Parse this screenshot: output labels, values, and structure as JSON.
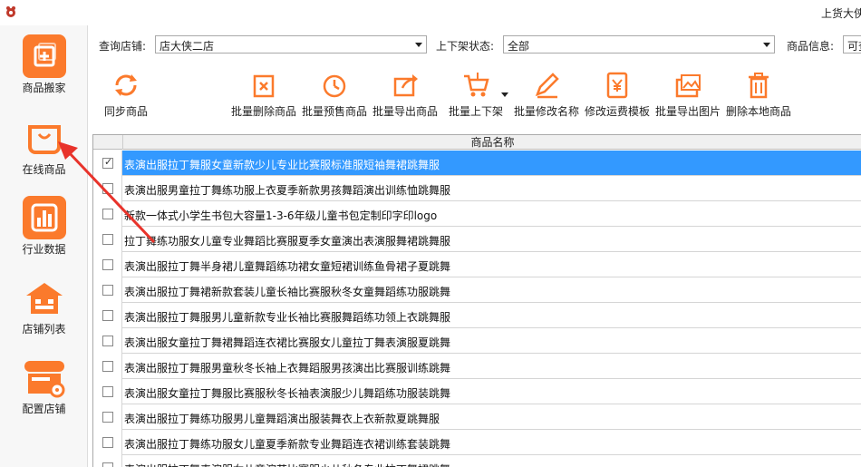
{
  "window": {
    "title": "上货大侠"
  },
  "sidebar": {
    "items": [
      {
        "label": "商品搬家",
        "icon": "plus-icon"
      },
      {
        "label": "在线商品",
        "icon": "bag-icon"
      },
      {
        "label": "行业数据",
        "icon": "bar-chart-icon"
      },
      {
        "label": "店铺列表",
        "icon": "store-icon"
      },
      {
        "label": "配置店铺",
        "icon": "store-gear-icon"
      }
    ]
  },
  "filters": {
    "shop_label": "查询店铺:",
    "shop_value": "店大侠二店",
    "status_label": "上下架状态:",
    "status_value": "全部",
    "info_label": "商品信息:",
    "info_value": "可查"
  },
  "toolbar": {
    "sync_label": "同步商品",
    "buttons": [
      "批量删除商品",
      "批量预售商品",
      "批量导出商品",
      "批量上下架",
      "批量修改名称",
      "修改运费模板",
      "批量导出图片",
      "删除本地商品"
    ]
  },
  "grid": {
    "header": "商品名称",
    "rows": [
      {
        "name": "表演出服拉丁舞服女童新款少儿专业比赛服标准服短袖舞裙跳舞服",
        "checked": true,
        "selected": true
      },
      {
        "name": "表演出服男童拉丁舞练功服上衣夏季新款男孩舞蹈演出训练恤跳舞服",
        "checked": false,
        "selected": false
      },
      {
        "name": "新款一体式小学生书包大容量1-3-6年级儿童书包定制印字印logo",
        "checked": false,
        "selected": false
      },
      {
        "name": "拉丁舞练功服女儿童专业舞蹈比赛服夏季女童演出表演服舞裙跳舞服",
        "checked": false,
        "selected": false
      },
      {
        "name": "表演出服拉丁舞半身裙儿童舞蹈练功裙女童短裙训练鱼骨裙子夏跳舞",
        "checked": false,
        "selected": false
      },
      {
        "name": "表演出服拉丁舞裙新款套装儿童长袖比赛服秋冬女童舞蹈练功服跳舞",
        "checked": false,
        "selected": false
      },
      {
        "name": "表演出服拉丁舞服男儿童新款专业长袖比赛服舞蹈练功领上衣跳舞服",
        "checked": false,
        "selected": false
      },
      {
        "name": "表演出服女童拉丁舞裙舞蹈连衣裙比赛服女儿童拉丁舞表演服夏跳舞",
        "checked": false,
        "selected": false
      },
      {
        "name": "表演出服拉丁舞服男童秋冬长袖上衣舞蹈服男孩演出比赛服训练跳舞",
        "checked": false,
        "selected": false
      },
      {
        "name": "表演出服女童拉丁舞服比赛服秋冬长袖表演服少儿舞蹈练功服装跳舞",
        "checked": false,
        "selected": false
      },
      {
        "name": "表演出服拉丁舞练功服男儿童舞蹈演出服装舞衣上衣新款夏跳舞服",
        "checked": false,
        "selected": false
      },
      {
        "name": "表演出服拉丁舞练功服女儿童夏季新款专业舞蹈连衣裙训练套装跳舞",
        "checked": false,
        "selected": false
      },
      {
        "name": "表演出服拉丁舞表演服女儿童演艺比赛服少儿秋冬专业拉丁舞裙跳舞",
        "checked": false,
        "selected": false
      }
    ]
  },
  "colors": {
    "accent": "#fb7a2c",
    "selection": "#3399ff",
    "annotation": "#e8332b"
  }
}
